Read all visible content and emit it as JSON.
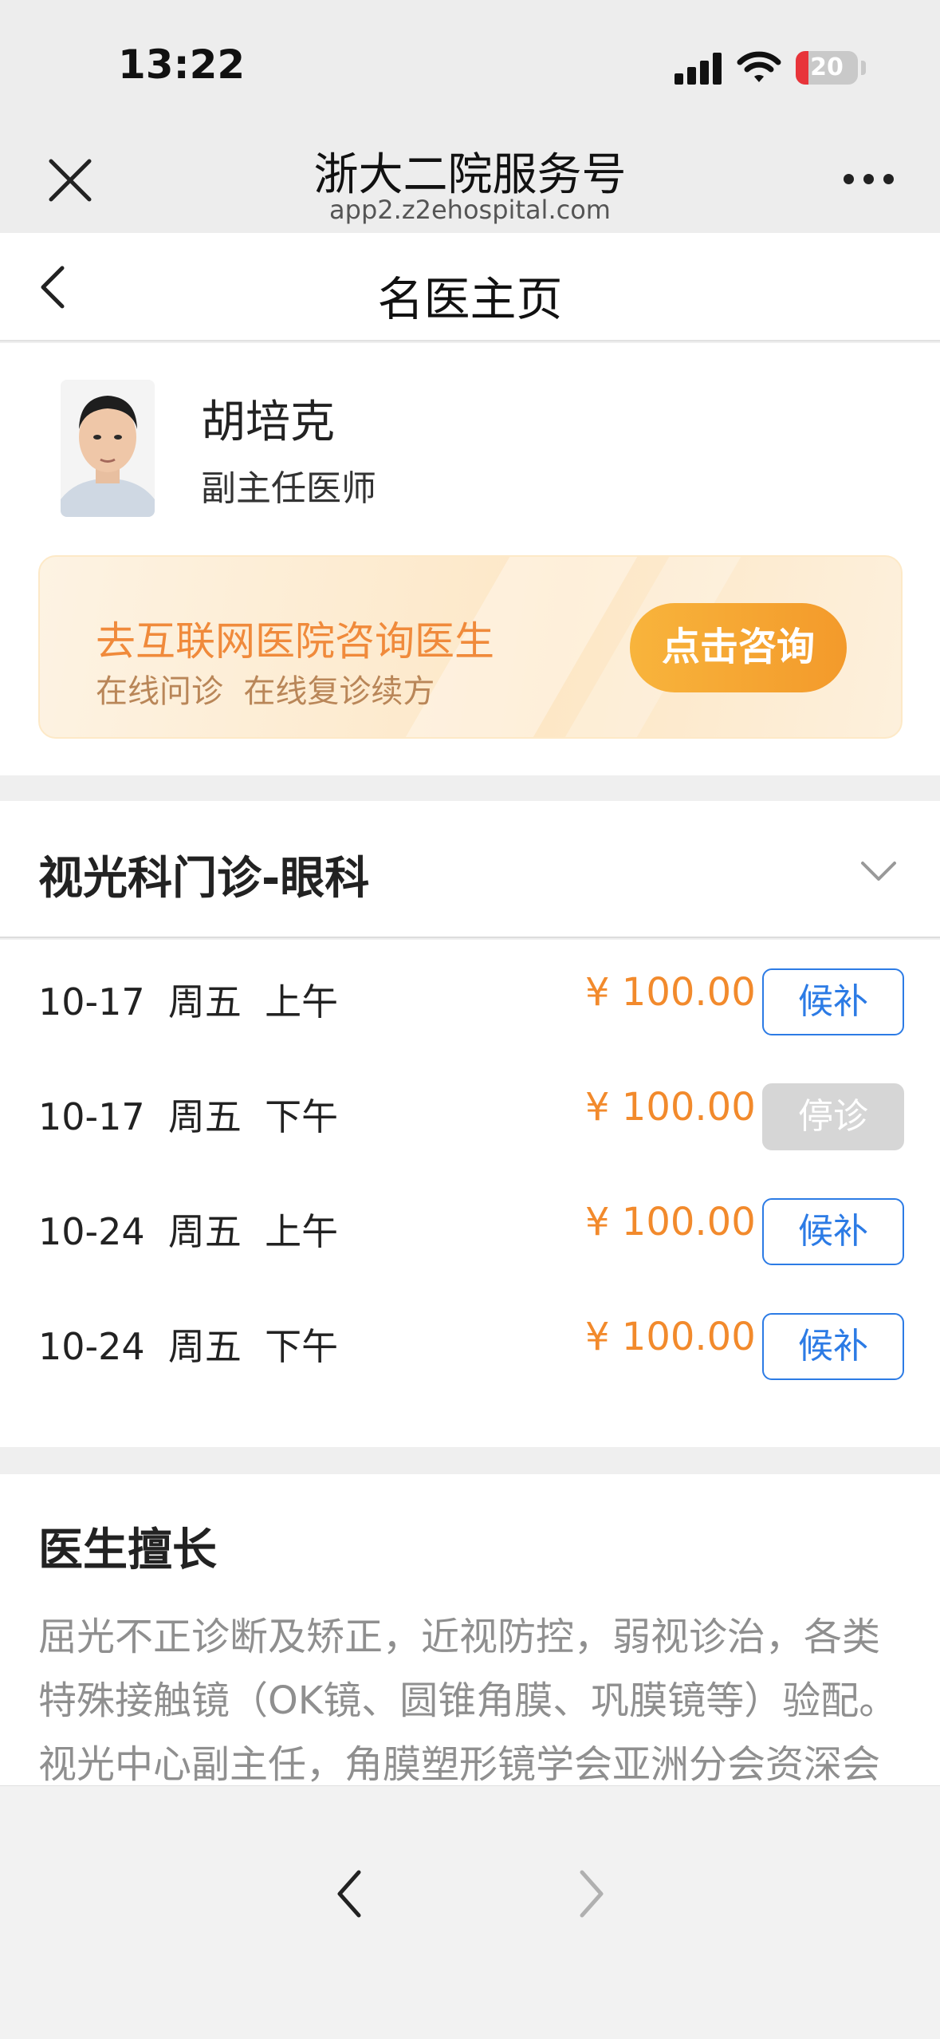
{
  "status_bar": {
    "time": "13:22",
    "battery": "20"
  },
  "wechat_nav": {
    "title": "浙大二院服务号",
    "url": "app2.z2ehospital.com"
  },
  "page": {
    "title": "名医主页"
  },
  "doctor": {
    "name": "胡培克",
    "title": "副主任医师"
  },
  "consult_banner": {
    "headline": "去互联网医院咨询医生",
    "subline": "在线问诊  在线复诊续方",
    "button_label": "点击咨询"
  },
  "department": {
    "name": "视光科门诊-眼科"
  },
  "schedule": [
    {
      "date": "10-17  周五  上午",
      "price": "¥ 100.00",
      "status": "候补",
      "available": true
    },
    {
      "date": "10-17  周五  下午",
      "price": "¥ 100.00",
      "status": "停诊",
      "available": false
    },
    {
      "date": "10-24  周五  上午",
      "price": "¥ 100.00",
      "status": "候补",
      "available": true
    },
    {
      "date": "10-24  周五  下午",
      "price": "¥ 100.00",
      "status": "候补",
      "available": true
    }
  ],
  "expertise": {
    "title": "医生擅长",
    "text": "屈光不正诊断及矫正，近视防控，弱视诊治，各类特殊接触镜（OK镜、圆锥角膜、巩膜镜等）验配。视光中心副主任，角膜塑形镜学会亚洲分会资深会员（OAOA），省预防医学会眼病预防"
  },
  "colors": {
    "accent_blue": "#2c7be5",
    "price_orange": "#f28a2c",
    "consult_orange": "#f39a2b"
  },
  "icons": {
    "close": "close-icon",
    "more": "more-icon",
    "back": "chevron-left-icon",
    "expand": "chevron-down-icon",
    "nav_back": "chevron-left-icon",
    "nav_forward": "chevron-right-icon"
  }
}
